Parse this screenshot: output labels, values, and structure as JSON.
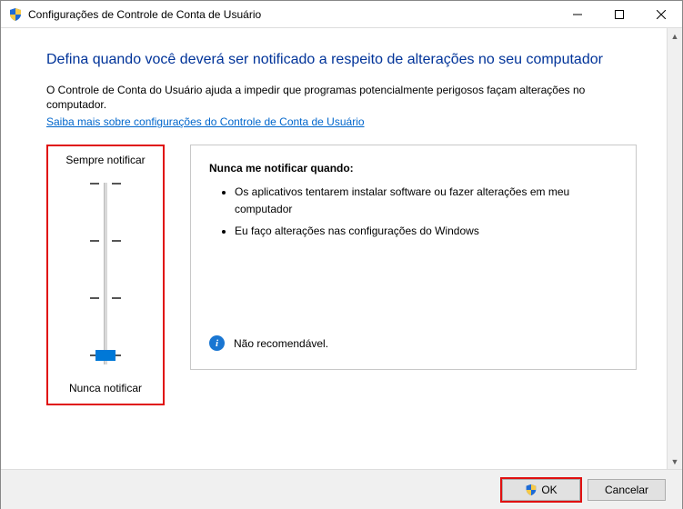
{
  "window": {
    "title": "Configurações de Controle de Conta de Usuário"
  },
  "content": {
    "heading": "Defina quando você deverá ser notificado a respeito de alterações no seu computador",
    "description": "O Controle de Conta do Usuário ajuda a impedir que programas potencialmente perigosos façam alterações no computador.",
    "link": "Saiba mais sobre configurações do Controle de Conta de Usuário"
  },
  "slider": {
    "topLabel": "Sempre notificar",
    "bottomLabel": "Nunca notificar",
    "position": 3,
    "levels": 4
  },
  "detail": {
    "heading": "Nunca me notificar quando:",
    "bullets": [
      "Os aplicativos tentarem instalar software ou fazer alterações em meu computador",
      "Eu faço alterações nas configurações do Windows"
    ],
    "recommendation": "Não recomendável."
  },
  "buttons": {
    "ok": "OK",
    "cancel": "Cancelar"
  }
}
